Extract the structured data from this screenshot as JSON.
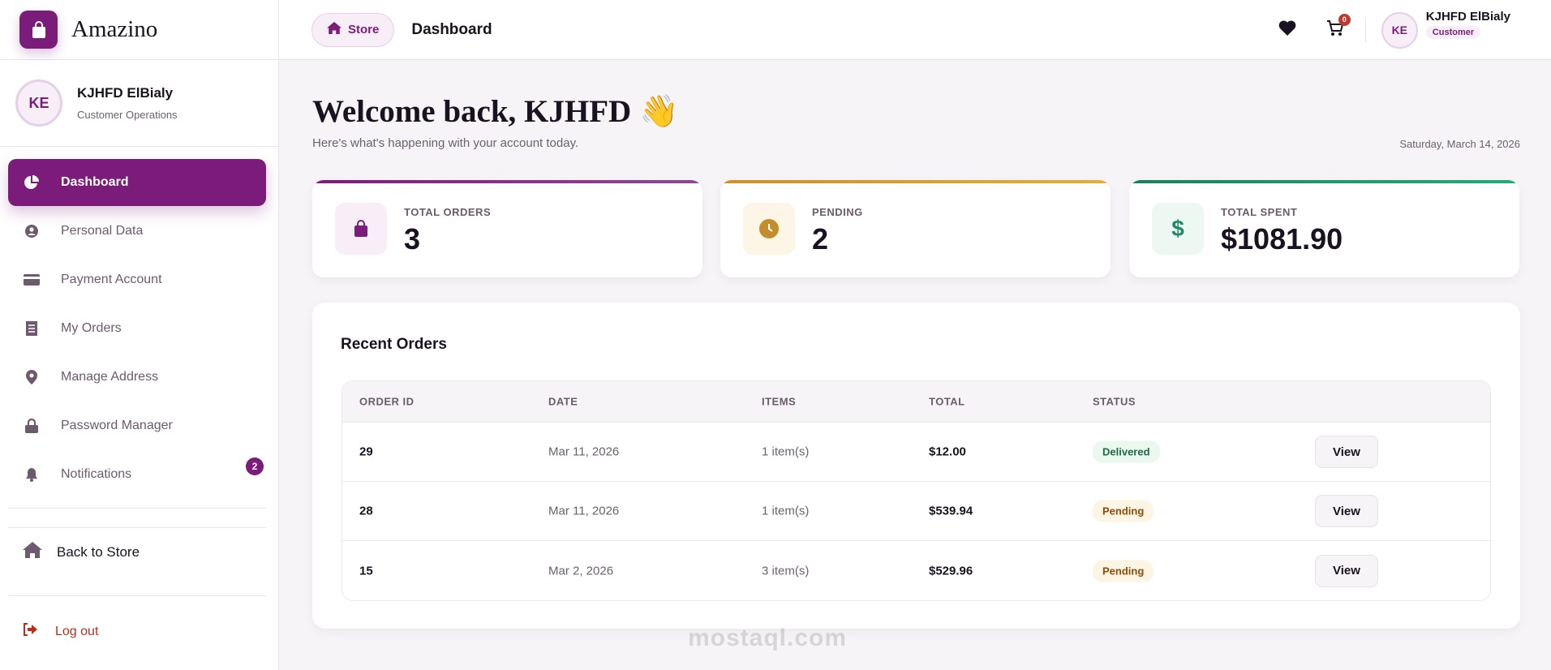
{
  "brand": {
    "name": "Amazino"
  },
  "profile": {
    "initials": "KE",
    "name": "KJHFD ElBialy",
    "role": "Customer Operations"
  },
  "nav": [
    {
      "label": "Dashboard",
      "icon": "pie-chart-icon"
    },
    {
      "label": "Personal Data",
      "icon": "user-circle-icon"
    },
    {
      "label": "Payment Account",
      "icon": "credit-card-icon"
    },
    {
      "label": "My Orders",
      "icon": "receipt-icon"
    },
    {
      "label": "Manage Address",
      "icon": "map-pin-icon"
    },
    {
      "label": "Password Manager",
      "icon": "lock-icon"
    },
    {
      "label": "Notifications",
      "icon": "bell-icon",
      "badge": "2"
    }
  ],
  "back_to_store": "Back to Store",
  "logout": "Log out",
  "header": {
    "store": "Store",
    "title": "Dashboard",
    "cart_count": "0",
    "user_initials": "KE",
    "user_name": "KJHFD ElBialy",
    "user_role": "Customer"
  },
  "welcome": {
    "title": "Welcome back, KJHFD 👋",
    "subtitle": "Here's what's happening with your account today.",
    "date": "Saturday, March 14, 2026"
  },
  "stats": [
    {
      "label": "TOTAL ORDERS",
      "value": "3",
      "color": "#7b1c7a"
    },
    {
      "label": "PENDING",
      "value": "2",
      "color": "#d19a2a"
    },
    {
      "label": "TOTAL SPENT",
      "value": "$1081.90",
      "color": "#1f8a66"
    }
  ],
  "recent": {
    "title": "Recent Orders",
    "columns": [
      "ORDER ID",
      "DATE",
      "ITEMS",
      "TOTAL",
      "STATUS"
    ],
    "rows": [
      {
        "id": "29",
        "date": "Mar 11, 2026",
        "items": "1 item(s)",
        "total": "$12.00",
        "status": "Delivered",
        "action": "View"
      },
      {
        "id": "28",
        "date": "Mar 11, 2026",
        "items": "1 item(s)",
        "total": "$539.94",
        "status": "Pending",
        "action": "View"
      },
      {
        "id": "15",
        "date": "Mar 2, 2026",
        "items": "3 item(s)",
        "total": "$529.96",
        "status": "Pending",
        "action": "View"
      }
    ]
  },
  "watermark": "mostaql.com"
}
